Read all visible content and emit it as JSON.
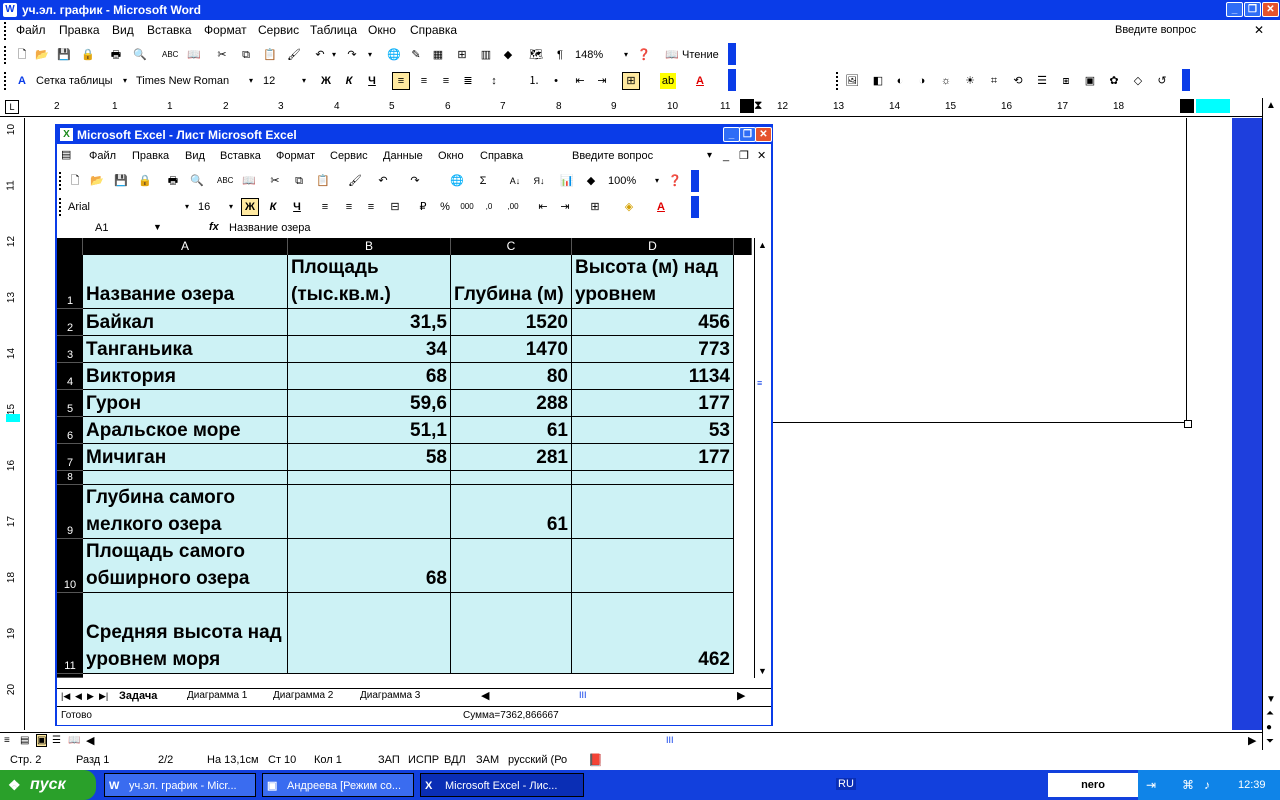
{
  "word": {
    "title": "уч.эл. график - Microsoft Word",
    "menu": [
      "Файл",
      "Правка",
      "Вид",
      "Вставка",
      "Формат",
      "Сервис",
      "Таблица",
      "Окно",
      "Справка"
    ],
    "help_placeholder": "Введите вопрос",
    "zoom": "148%",
    "read_label": "Чтение",
    "style": "Сетка таблицы",
    "font": "Times New Roman",
    "font_size": "12",
    "ruler_numbers": [
      "2",
      "1",
      "1",
      "2",
      "3",
      "4",
      "5",
      "6",
      "7",
      "8",
      "9",
      "10",
      "11",
      "12",
      "13",
      "14",
      "15",
      "16",
      "17",
      "18"
    ],
    "vruler_numbers": [
      "10",
      "11",
      "12",
      "13",
      "14",
      "15",
      "16",
      "17",
      "18",
      "19",
      "20"
    ],
    "status": {
      "page": "Стр. 2",
      "section": "Разд 1",
      "pages": "2/2",
      "at": "На 13,1см",
      "line": "Ст 10",
      "col": "Кол 1",
      "rec": "ЗАП",
      "trk": "ИСПР",
      "ext": "ВДЛ",
      "ovr": "ЗАМ",
      "lang": "русский (Ро"
    }
  },
  "excel": {
    "title": "Microsoft Excel - Лист Microsoft Excel",
    "menu": [
      "Файл",
      "Правка",
      "Вид",
      "Вставка",
      "Формат",
      "Сервис",
      "Данные",
      "Окно",
      "Справка"
    ],
    "help_placeholder": "Введите вопрос",
    "zoom": "100%",
    "font": "Arial",
    "font_size": "16",
    "name_box": "A1",
    "formula": "Название озера",
    "columns": [
      "A",
      "B",
      "C",
      "D"
    ],
    "rows": [
      {
        "n": "1",
        "a": "Название озера",
        "b": "Площадь (тыс.кв.м.)",
        "c": "Глубина (м)",
        "d": "Высота (м) над уровнем"
      },
      {
        "n": "2",
        "a": "Байкал",
        "b": "31,5",
        "c": "1520",
        "d": "456"
      },
      {
        "n": "3",
        "a": "Танганьика",
        "b": "34",
        "c": "1470",
        "d": "773"
      },
      {
        "n": "4",
        "a": "Виктория",
        "b": "68",
        "c": "80",
        "d": "1134"
      },
      {
        "n": "5",
        "a": "Гурон",
        "b": "59,6",
        "c": "288",
        "d": "177"
      },
      {
        "n": "6",
        "a": "Аральское море",
        "b": "51,1",
        "c": "61",
        "d": "53"
      },
      {
        "n": "7",
        "a": "Мичиган",
        "b": "58",
        "c": "281",
        "d": "177"
      },
      {
        "n": "8",
        "a": "",
        "b": "",
        "c": "",
        "d": ""
      },
      {
        "n": "9",
        "a": "Глубина самого мелкого озера",
        "b": "",
        "c": "61",
        "d": ""
      },
      {
        "n": "10",
        "a": "Площадь самого обширного озера",
        "b": "68",
        "c": "",
        "d": ""
      },
      {
        "n": "11",
        "a": "Средняя высота над уровнем моря",
        "b": "",
        "c": "",
        "d": "462"
      }
    ],
    "sheet_tabs": [
      "Задача",
      "Диаграмма 1",
      "Диаграмма 2",
      "Диаграмма 3"
    ],
    "status_ready": "Готово",
    "status_sum": "Сумма=7362,866667"
  },
  "taskbar": {
    "start": "пуск",
    "tasks": [
      "уч.эл. график - Micr...",
      "Андреева [Режим со...",
      "Microsoft Excel - Лис..."
    ],
    "lang": "RU",
    "time": "12:39",
    "nero": "nero"
  },
  "colors": {
    "xp_blue": "#0a3ce8",
    "cell_fill": "#cdf2f5",
    "start_green": "#2aa02a"
  }
}
